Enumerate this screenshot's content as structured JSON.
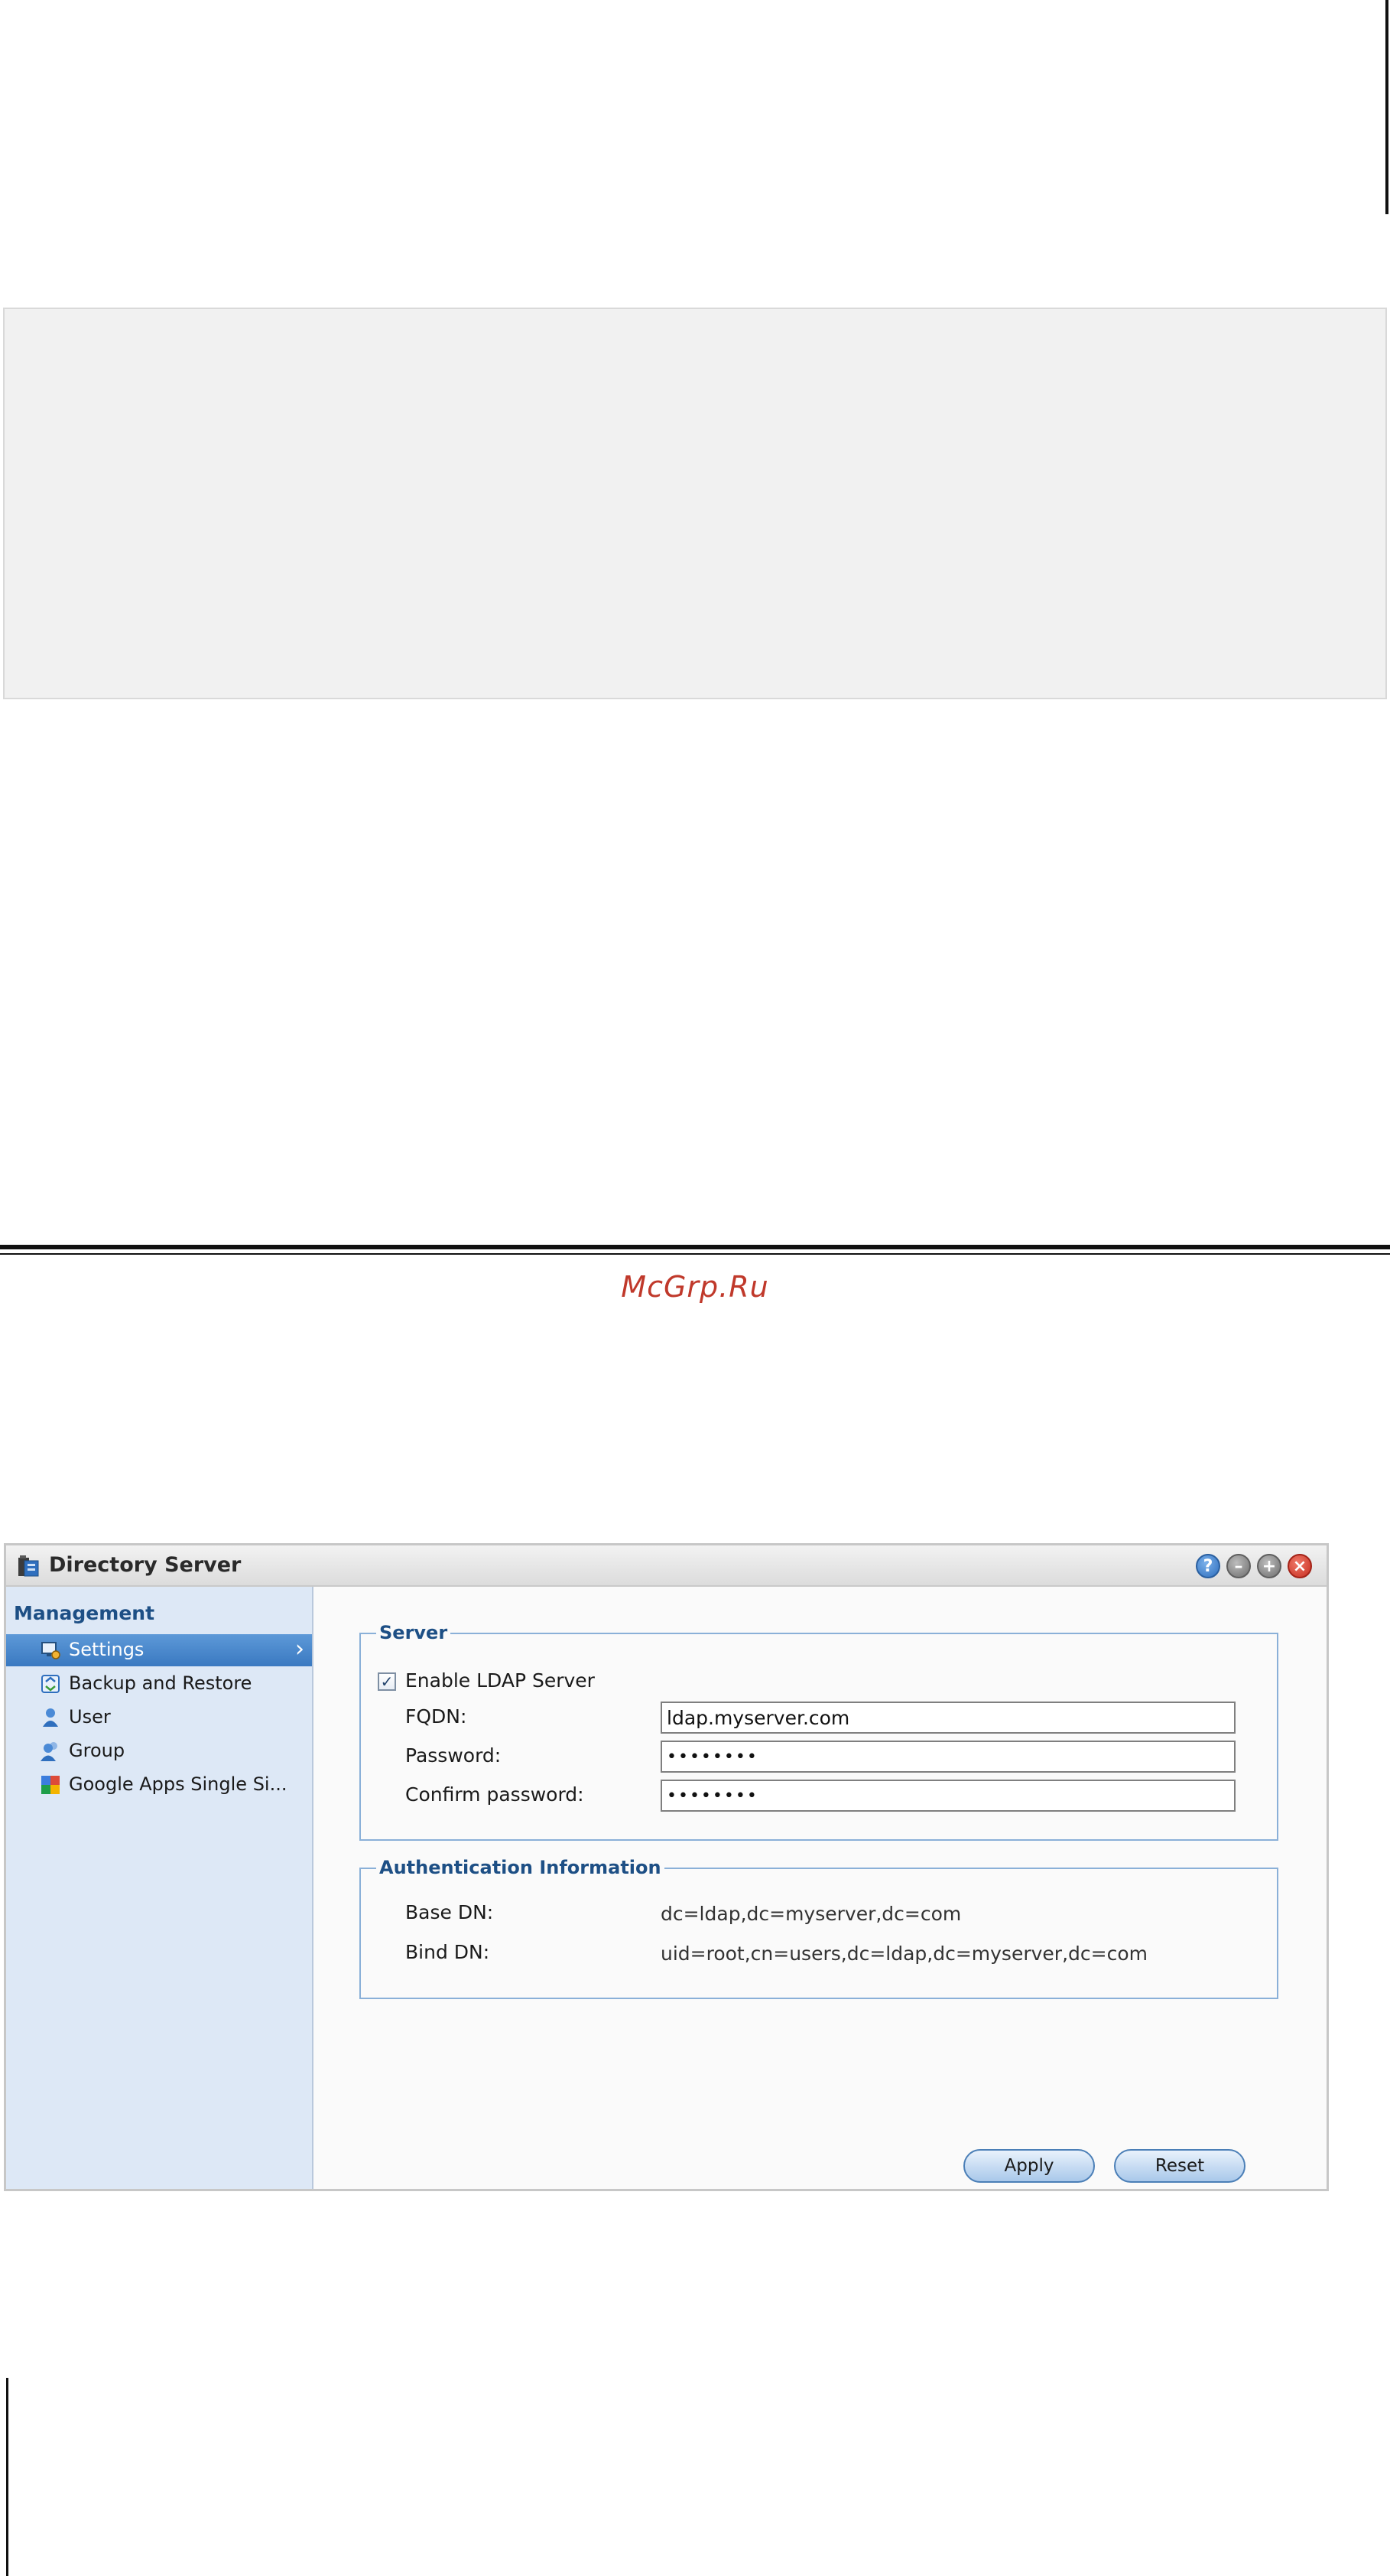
{
  "watermark": "McGrp.Ru",
  "window": {
    "title": "Directory Server",
    "controls": {
      "help": "?",
      "minimize": "–",
      "maximize": "+",
      "close": "×"
    }
  },
  "sidebar": {
    "heading": "Management",
    "items": [
      {
        "label": "Settings",
        "icon": "settings-icon",
        "selected": true
      },
      {
        "label": "Backup and Restore",
        "icon": "backup-icon"
      },
      {
        "label": "User",
        "icon": "user-icon"
      },
      {
        "label": "Group",
        "icon": "group-icon"
      },
      {
        "label": "Google Apps Single Si...",
        "icon": "google-apps-icon"
      }
    ]
  },
  "server": {
    "legend": "Server",
    "enable_label": "Enable LDAP Server",
    "enable_checked": true,
    "fqdn_label": "FQDN:",
    "fqdn_value": "ldap.myserver.com",
    "password_label": "Password:",
    "password_value": "••••••••",
    "confirm_label": "Confirm password:",
    "confirm_value": "••••••••"
  },
  "auth": {
    "legend": "Authentication Information",
    "base_dn_label": "Base DN:",
    "base_dn_value": "dc=ldap,dc=myserver,dc=com",
    "bind_dn_label": "Bind DN:",
    "bind_dn_value": "uid=root,cn=users,dc=ldap,dc=myserver,dc=com"
  },
  "buttons": {
    "apply": "Apply",
    "reset": "Reset"
  },
  "colors": {
    "accent": "#3a79c1",
    "sidebar_bg": "#dde8f6",
    "watermark": "#c0392b",
    "close_button": "#c62d1f"
  }
}
